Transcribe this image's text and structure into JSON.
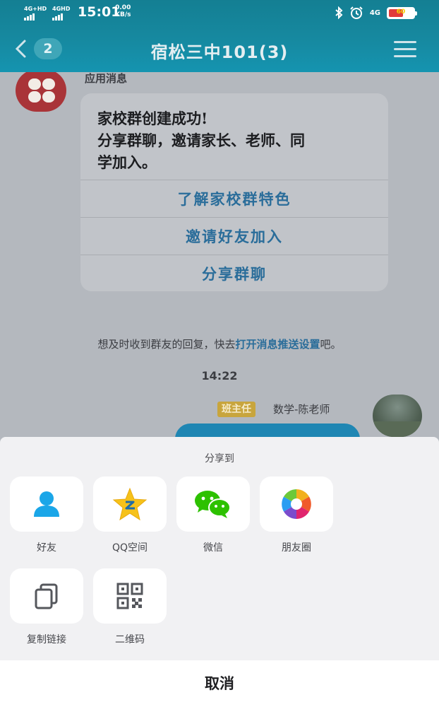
{
  "status_bar": {
    "signal1_label": "4G+HD",
    "signal2_label": "4GHD",
    "time": "15:01",
    "net_speed": "0.00",
    "net_unit": "KB/s",
    "network_type": "4G",
    "battery_label": "60",
    "battery_percent": 60
  },
  "nav": {
    "back_count": "2",
    "title": "宿松三中101(3)"
  },
  "chat": {
    "app_sender": "应用消息",
    "card": {
      "lines": [
        "家校群创建成功!",
        "分享群聊，邀请家长、老师、同",
        "学加入。"
      ],
      "actions": [
        "了解家校群特色",
        "邀请好友加入",
        "分享群聊"
      ]
    },
    "tip_prefix": "想及时收到群友的回复，快去",
    "tip_link": "打开消息推送设置",
    "tip_suffix": "吧。",
    "timestamp": "14:22",
    "role_badge": "班主任",
    "sender_name": "数学-陈老师"
  },
  "share_sheet": {
    "title": "分享到",
    "items": [
      {
        "label": "好友",
        "icon": "friend-icon"
      },
      {
        "label": "QQ空间",
        "icon": "qzone-icon"
      },
      {
        "label": "微信",
        "icon": "wechat-icon"
      },
      {
        "label": "朋友圈",
        "icon": "moments-icon"
      },
      {
        "label": "复制链接",
        "icon": "copy-link-icon"
      },
      {
        "label": "二维码",
        "icon": "qr-code-icon"
      }
    ],
    "cancel_label": "取消"
  },
  "colors": {
    "header": "#1689a0",
    "link": "#2a6d9a",
    "badge": "#c8a53d",
    "friend_icon": "#1aa6e8",
    "wechat_green": "#2dc100"
  }
}
